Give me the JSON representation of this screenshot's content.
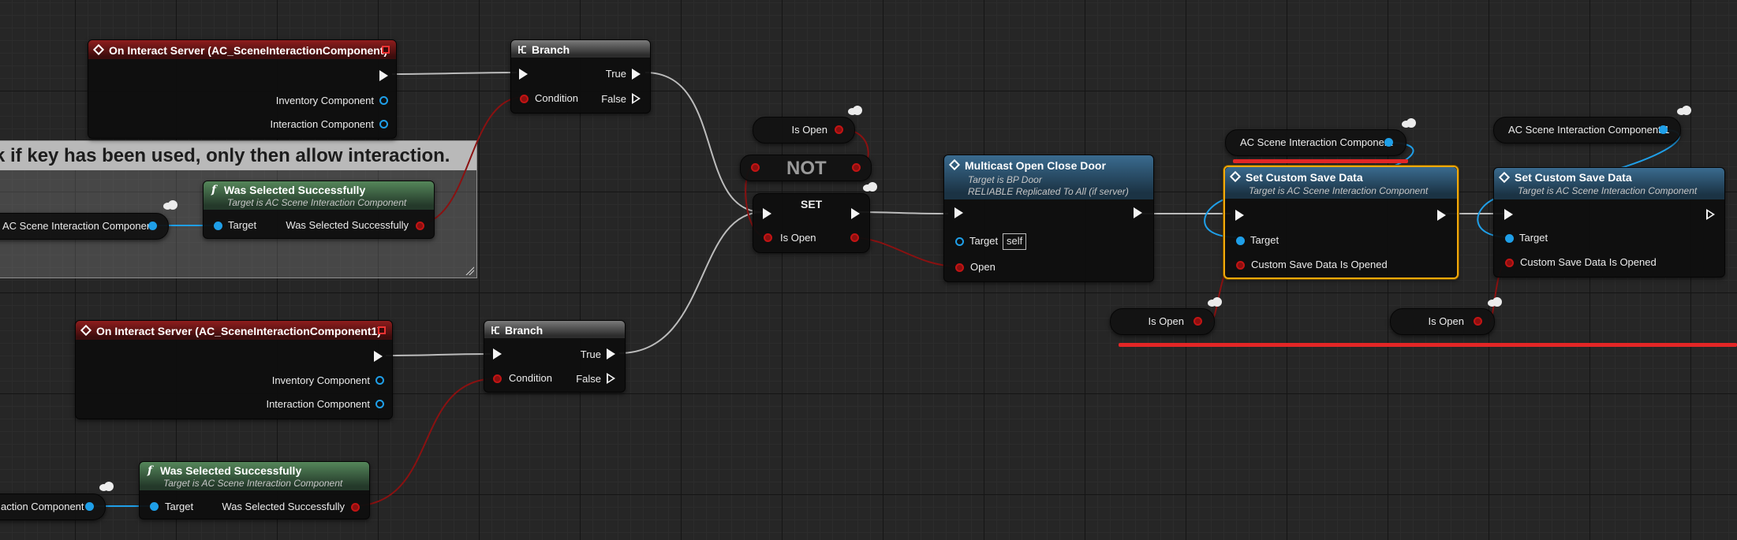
{
  "comment": {
    "title": "k if key has been used, only then allow interaction."
  },
  "event1": {
    "title": "On Interact Server (AC_SceneInteractionComponent)",
    "pin_inventory": "Inventory Component",
    "pin_interaction": "Interaction Component"
  },
  "event2": {
    "title": "On Interact Server (AC_SceneInteractionComponent1)",
    "pin_inventory": "Inventory Component",
    "pin_interaction": "Interaction Component"
  },
  "branch1": {
    "title": "Branch",
    "true_label": "True",
    "false_label": "False",
    "condition_label": "Condition"
  },
  "branch2": {
    "title": "Branch",
    "true_label": "True",
    "false_label": "False",
    "condition_label": "Condition"
  },
  "was_selected1": {
    "title": "Was Selected Successfully",
    "subtitle": "Target is AC Scene Interaction Component",
    "target_label": "Target",
    "out_label": "Was Selected Successfully"
  },
  "was_selected2": {
    "title": "Was Selected Successfully",
    "subtitle": "Target is AC Scene Interaction Component",
    "target_label": "Target",
    "out_label": "Was Selected Successfully"
  },
  "var_ac_scene1": {
    "label": "AC Scene Interaction Component"
  },
  "var_ac_scene2": {
    "label": "action Component"
  },
  "var_is_open_top": {
    "label": "Is Open"
  },
  "not_node": {
    "label": "NOT"
  },
  "set_node": {
    "title": "SET",
    "pin_is_open": "Is Open"
  },
  "multicast": {
    "title": "Multicast Open Close Door",
    "subtitle1": "Target is BP Door",
    "subtitle2": "RELIABLE Replicated To All (if server)",
    "target_label": "Target",
    "self_value": "self",
    "open_label": "Open"
  },
  "var_ac_scene_top": {
    "label": "AC Scene Interaction Component"
  },
  "var_ac_scene_top2": {
    "label": "AC Scene Interaction Component 1"
  },
  "save_data1": {
    "title": "Set Custom Save Data",
    "subtitle": "Target is AC Scene Interaction Component",
    "target_label": "Target",
    "param_label": "Custom Save Data Is Opened"
  },
  "save_data2": {
    "title": "Set Custom Save Data",
    "subtitle": "Target is AC Scene Interaction Component",
    "target_label": "Target",
    "param_label": "Custom Save Data Is Opened"
  },
  "var_is_open_b1": {
    "label": "Is Open"
  },
  "var_is_open_b2": {
    "label": "Is Open"
  },
  "colors": {
    "exec": "#f5f5f5",
    "object_pin": "#1f9fe8",
    "bool_pin": "#c21414",
    "selection": "#f2a90a",
    "error_underline": "#e32626"
  }
}
